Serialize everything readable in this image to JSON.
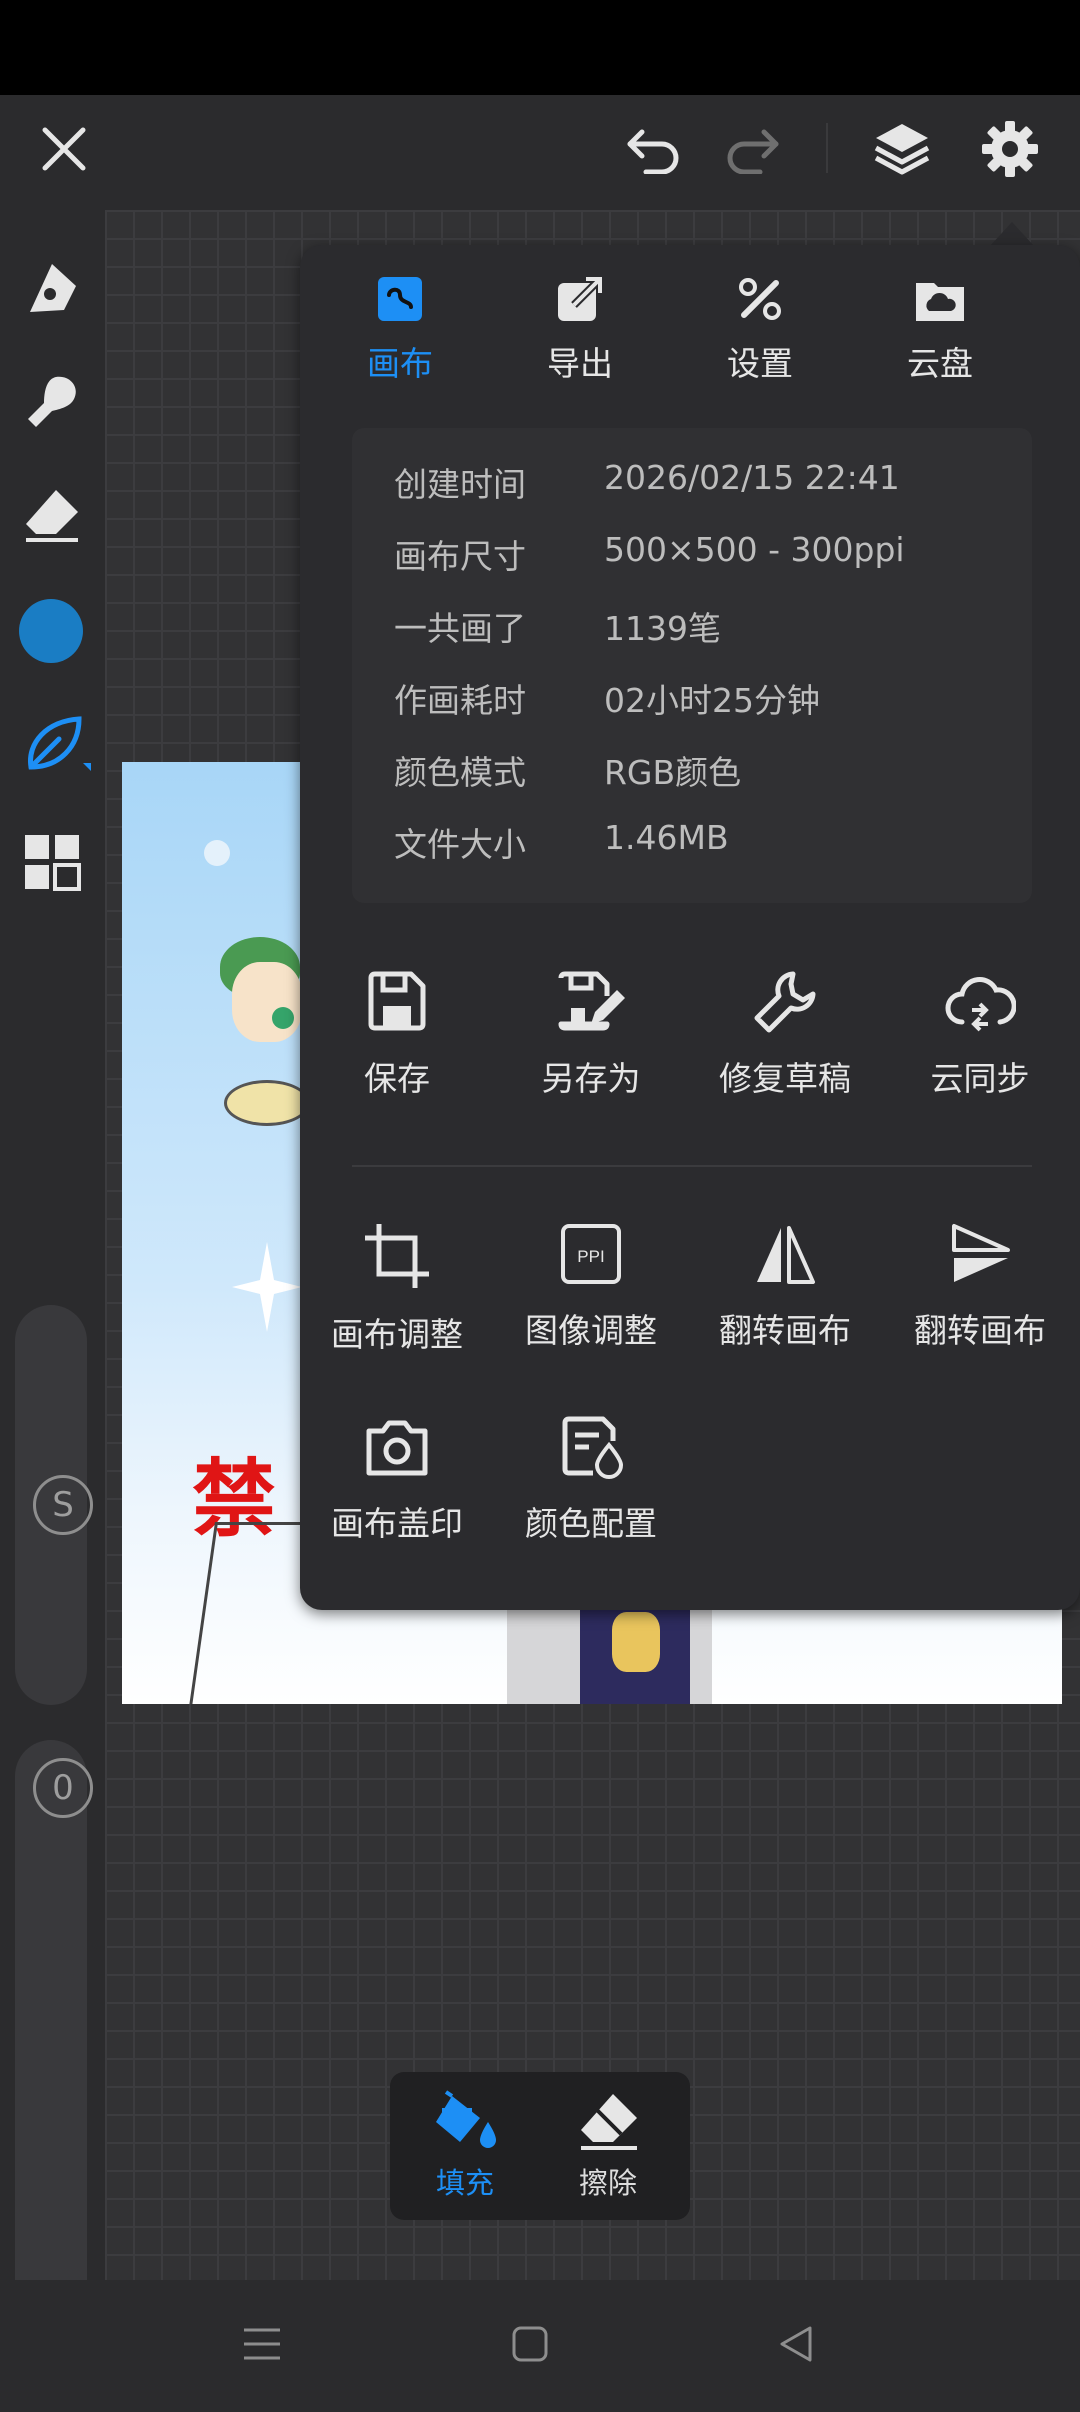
{
  "toolbar": {
    "icons": [
      "close-icon",
      "undo-icon",
      "redo-icon",
      "layers-icon",
      "settings-icon"
    ]
  },
  "tools": [
    "pen-icon",
    "smudge-icon",
    "eraser-icon",
    "color-swatch",
    "brush-leaf-icon",
    "grid-icon"
  ],
  "colors": {
    "accent": "#1d8ff5",
    "swatch": "#1a7dc4",
    "panel": "#2b2b2e"
  },
  "menu": {
    "tabs": [
      {
        "label": "画布",
        "icon": "canvas-icon"
      },
      {
        "label": "导出",
        "icon": "export-icon"
      },
      {
        "label": "设置",
        "icon": "tools-icon"
      },
      {
        "label": "云盘",
        "icon": "cloud-folder-icon"
      }
    ],
    "info": [
      {
        "key": "创建时间",
        "value": "2026/02/15 22:41"
      },
      {
        "key": "画布尺寸",
        "value": "500×500 - 300ppi"
      },
      {
        "key": "一共画了",
        "value": "1139笔"
      },
      {
        "key": "作画耗时",
        "value": "02小时25分钟"
      },
      {
        "key": "颜色模式",
        "value": "RGB颜色"
      },
      {
        "key": "文件大小",
        "value": "1.46MB"
      }
    ],
    "actions_row1": [
      {
        "label": "保存",
        "icon": "save-icon"
      },
      {
        "label": "另存为",
        "icon": "save-as-icon"
      },
      {
        "label": "修复草稿",
        "icon": "wrench-icon"
      },
      {
        "label": "云同步",
        "icon": "cloud-sync-icon"
      }
    ],
    "actions_row2": [
      {
        "label": "画布调整",
        "icon": "crop-icon"
      },
      {
        "label": "图像调整",
        "icon": "ppi-icon"
      },
      {
        "label": "翻转画布",
        "icon": "flip-horizontal-icon"
      },
      {
        "label": "翻转画布",
        "icon": "flip-vertical-icon"
      }
    ],
    "actions_row3": [
      {
        "label": "画布盖印",
        "icon": "camera-icon"
      },
      {
        "label": "颜色配置",
        "icon": "color-profile-icon"
      }
    ]
  },
  "sliders": {
    "size_label": "S",
    "opacity_label": "0"
  },
  "artwork": {
    "stamp_text": "禁"
  },
  "bottom_popup": [
    {
      "label": "填充",
      "icon": "fill-bucket-icon"
    },
    {
      "label": "擦除",
      "icon": "eraser-icon"
    }
  ],
  "navbar": [
    "menu-icon",
    "home-icon",
    "back-icon"
  ]
}
